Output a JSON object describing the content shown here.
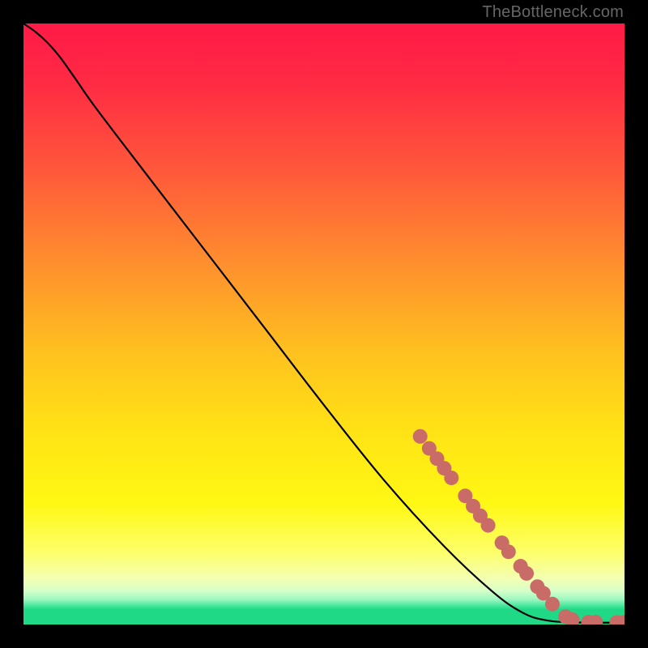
{
  "attribution": "TheBottleneck.com",
  "chart_data": {
    "type": "line",
    "title": "",
    "xlabel": "",
    "ylabel": "",
    "xlim": [
      0,
      100
    ],
    "ylim": [
      0,
      100
    ],
    "gradient_stops": [
      {
        "offset": 0.0,
        "color": "#ff1a47"
      },
      {
        "offset": 0.1,
        "color": "#ff2b44"
      },
      {
        "offset": 0.25,
        "color": "#ff5a3a"
      },
      {
        "offset": 0.4,
        "color": "#ff8f2e"
      },
      {
        "offset": 0.55,
        "color": "#ffc21f"
      },
      {
        "offset": 0.68,
        "color": "#ffe315"
      },
      {
        "offset": 0.8,
        "color": "#fff814"
      },
      {
        "offset": 0.88,
        "color": "#fdff6a"
      },
      {
        "offset": 0.925,
        "color": "#f3ffb4"
      },
      {
        "offset": 0.945,
        "color": "#d3ffc9"
      },
      {
        "offset": 0.958,
        "color": "#9ef7c1"
      },
      {
        "offset": 0.968,
        "color": "#4de79f"
      },
      {
        "offset": 0.975,
        "color": "#1fd987"
      },
      {
        "offset": 1.0,
        "color": "#1fd987"
      }
    ],
    "curve_points": [
      {
        "x": 0.0,
        "y": 100.0
      },
      {
        "x": 2.0,
        "y": 98.6
      },
      {
        "x": 4.0,
        "y": 96.8
      },
      {
        "x": 6.0,
        "y": 94.5
      },
      {
        "x": 8.5,
        "y": 91.0
      },
      {
        "x": 12.0,
        "y": 86.0
      },
      {
        "x": 20.0,
        "y": 75.5
      },
      {
        "x": 30.0,
        "y": 62.5
      },
      {
        "x": 40.0,
        "y": 49.5
      },
      {
        "x": 50.0,
        "y": 36.5
      },
      {
        "x": 60.0,
        "y": 24.0
      },
      {
        "x": 70.0,
        "y": 13.0
      },
      {
        "x": 78.0,
        "y": 5.5
      },
      {
        "x": 83.0,
        "y": 2.0
      },
      {
        "x": 87.0,
        "y": 0.7
      },
      {
        "x": 92.0,
        "y": 0.35
      },
      {
        "x": 100.0,
        "y": 0.3
      }
    ],
    "dot_color": "#c96b66",
    "dot_radius": 9,
    "highlighted_points": [
      {
        "x": 66.0,
        "y": 31.3
      },
      {
        "x": 67.5,
        "y": 29.3
      },
      {
        "x": 68.8,
        "y": 27.6
      },
      {
        "x": 70.0,
        "y": 26.0
      },
      {
        "x": 71.2,
        "y": 24.4
      },
      {
        "x": 73.5,
        "y": 21.4
      },
      {
        "x": 74.8,
        "y": 19.7
      },
      {
        "x": 76.0,
        "y": 18.1
      },
      {
        "x": 77.3,
        "y": 16.5
      },
      {
        "x": 79.6,
        "y": 13.6
      },
      {
        "x": 80.7,
        "y": 12.1
      },
      {
        "x": 82.7,
        "y": 9.7
      },
      {
        "x": 83.7,
        "y": 8.5
      },
      {
        "x": 85.5,
        "y": 6.3
      },
      {
        "x": 86.5,
        "y": 5.2
      },
      {
        "x": 88.0,
        "y": 3.4
      },
      {
        "x": 90.2,
        "y": 1.3
      },
      {
        "x": 91.3,
        "y": 0.8
      },
      {
        "x": 94.0,
        "y": 0.4
      },
      {
        "x": 95.2,
        "y": 0.4
      },
      {
        "x": 98.7,
        "y": 0.35
      },
      {
        "x": 99.9,
        "y": 0.35
      }
    ]
  }
}
